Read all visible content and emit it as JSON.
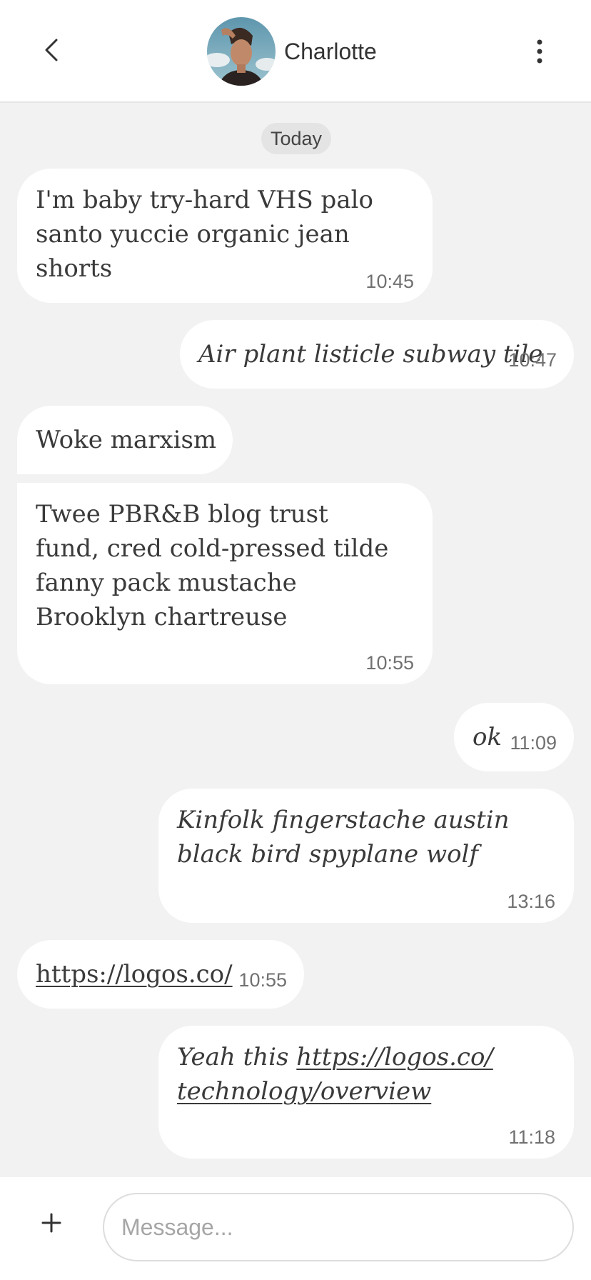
{
  "header": {
    "contact_name": "Charlotte",
    "back_icon": "chevron-left-icon",
    "menu_icon": "more-vertical-icon"
  },
  "date_divider": "Today",
  "messages": [
    {
      "direction": "incoming",
      "text": "I'm baby try-hard VHS palo santo yuccie organic jean shorts",
      "time": "10:45"
    },
    {
      "direction": "outgoing",
      "text": "Air plant listicle subway tile",
      "time": "10:47"
    },
    {
      "direction": "incoming",
      "text": "Woke marxism",
      "time": ""
    },
    {
      "direction": "incoming",
      "text": "Twee PBR&B blog trust fund, cred cold-pressed tilde fanny pack mustache Brooklyn chartreuse",
      "time": "10:55"
    },
    {
      "direction": "outgoing",
      "text": "ok",
      "time": "11:09"
    },
    {
      "direction": "outgoing",
      "text": "Kinfolk fingerstache austin black bird spyplane wolf",
      "time": "13:16"
    },
    {
      "direction": "incoming",
      "text": "https://logos.co/",
      "time": "10:55"
    },
    {
      "direction": "outgoing",
      "text_prefix": "Yeah this ",
      "link_line1": "https://logos.co/",
      "link_line2": "technology/overview",
      "time": "11:18"
    }
  ],
  "composer": {
    "plus_icon": "plus-icon",
    "placeholder": "Message..."
  },
  "colors": {
    "background": "#f2f2f2",
    "bubble": "#ffffff",
    "text": "#3a3a3a",
    "timestamp": "#707070"
  }
}
